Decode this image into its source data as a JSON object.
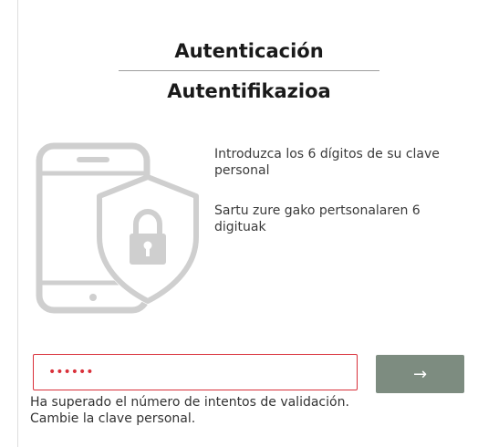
{
  "header": {
    "title_es": "Autenticación",
    "title_eu": "Autentifikazioa"
  },
  "illustration": {
    "icon": "phone-shield-lock-icon",
    "color": "#cfcfcf"
  },
  "instructions": {
    "es": "Introduzca los 6 dígitos de su clave personal",
    "eu": "Sartu zure gako pertsonalaren 6 digituak"
  },
  "form": {
    "code_value": "••••••",
    "submit_label": "→",
    "submit_icon": "arrow-right-icon",
    "error_color": "#d9303a",
    "button_color": "#7d8c80",
    "error_message": "Ha superado el número de intentos de validación. Cambie la clave personal."
  }
}
